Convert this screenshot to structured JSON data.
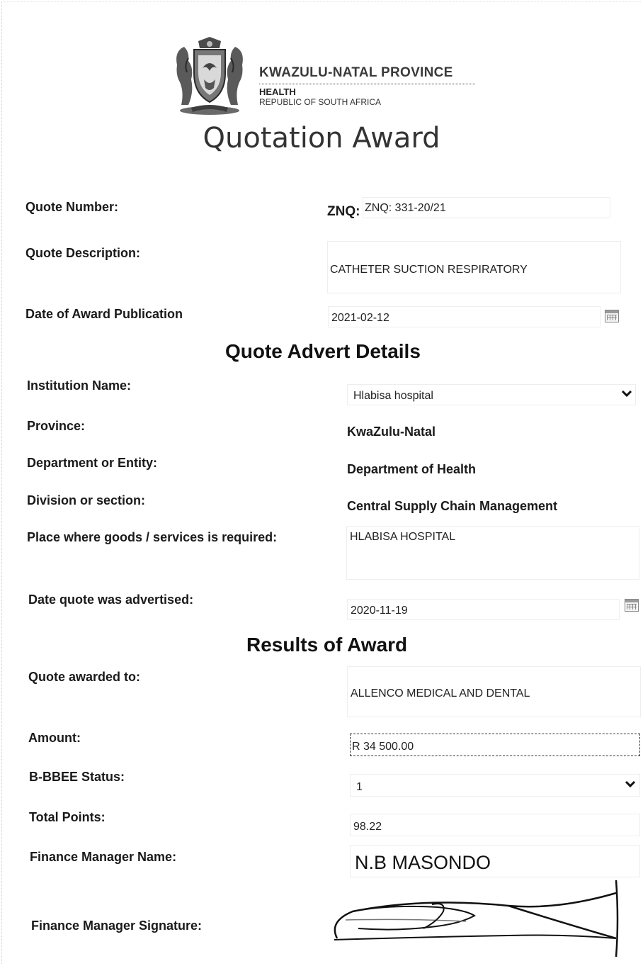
{
  "header": {
    "province": "KWAZULU-NATAL PROVINCE",
    "department": "HEALTH",
    "country": "REPUBLIC OF SOUTH AFRICA",
    "title": "Quotation Award",
    "crest_icon": "coat-of-arms-icon"
  },
  "quote": {
    "number_label": "Quote Number:",
    "znq_label": "ZNQ:",
    "number_value": "ZNQ: 331-20/21",
    "description_label": "Quote Description:",
    "description_value": "CATHETER SUCTION RESPIRATORY",
    "publication_label": "Date of Award Publication",
    "publication_value": "2021-02-12"
  },
  "advert": {
    "heading": "Quote Advert Details",
    "institution_label": "Institution Name:",
    "institution_value": "Hlabisa hospital",
    "province_label": "Province:",
    "province_value": "KwaZulu-Natal",
    "department_label": "Department or Entity:",
    "department_value": "Department of Health",
    "division_label": "Division or section:",
    "division_value": "Central Supply Chain Management",
    "place_label": "Place where goods /  services is required:",
    "place_value": "HLABISA HOSPITAL",
    "advertised_label": "Date quote was advertised:",
    "advertised_value": "2020-11-19"
  },
  "results": {
    "heading": "Results of Award",
    "awarded_label": "Quote awarded to:",
    "awarded_value": "ALLENCO MEDICAL AND DENTAL",
    "amount_label": "Amount:",
    "amount_value": "R 34 500.00",
    "bbbee_label": "B-BBEE Status:",
    "bbbee_value": "1",
    "points_label": "Total Points:",
    "points_value": "98.22",
    "manager_label": "Finance Manager Name:",
    "manager_value": "N.B MASONDO",
    "signature_label": "Finance Manager Signature:"
  }
}
